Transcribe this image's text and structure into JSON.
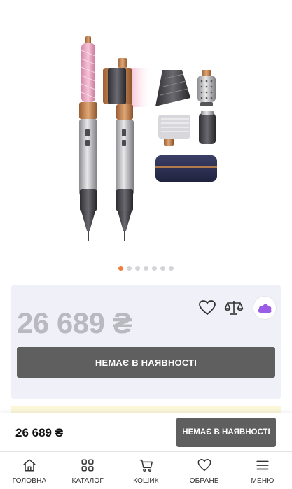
{
  "product": {
    "price": "26 689 ₴",
    "availability_label": "НЕМАЄ В НАЯВНОСТІ"
  },
  "gallery": {
    "slide_count": 7,
    "active_index": 0
  },
  "icons": {
    "wishlist": "heart-icon",
    "compare": "scales-icon",
    "promo": "purple-cloud-icon"
  },
  "sticky_bar": {
    "price": "26 689 ₴",
    "button_label": "НЕМАЄ В НАЯВНОСТІ"
  },
  "bottom_nav": {
    "items": [
      {
        "label": "ГОЛОВНА",
        "icon": "home-icon"
      },
      {
        "label": "КАТАЛОГ",
        "icon": "grid-icon"
      },
      {
        "label": "КОШИК",
        "icon": "cart-icon"
      },
      {
        "label": "ОБРАНЕ",
        "icon": "heart-icon"
      },
      {
        "label": "МЕНЮ",
        "icon": "menu-icon"
      }
    ]
  },
  "colors": {
    "accent": "#f07c3f",
    "card_bg": "#f0f0f8",
    "button_bg": "#5f5f5f",
    "price_muted": "#b9b9bf",
    "promo": "#9b5de5"
  }
}
